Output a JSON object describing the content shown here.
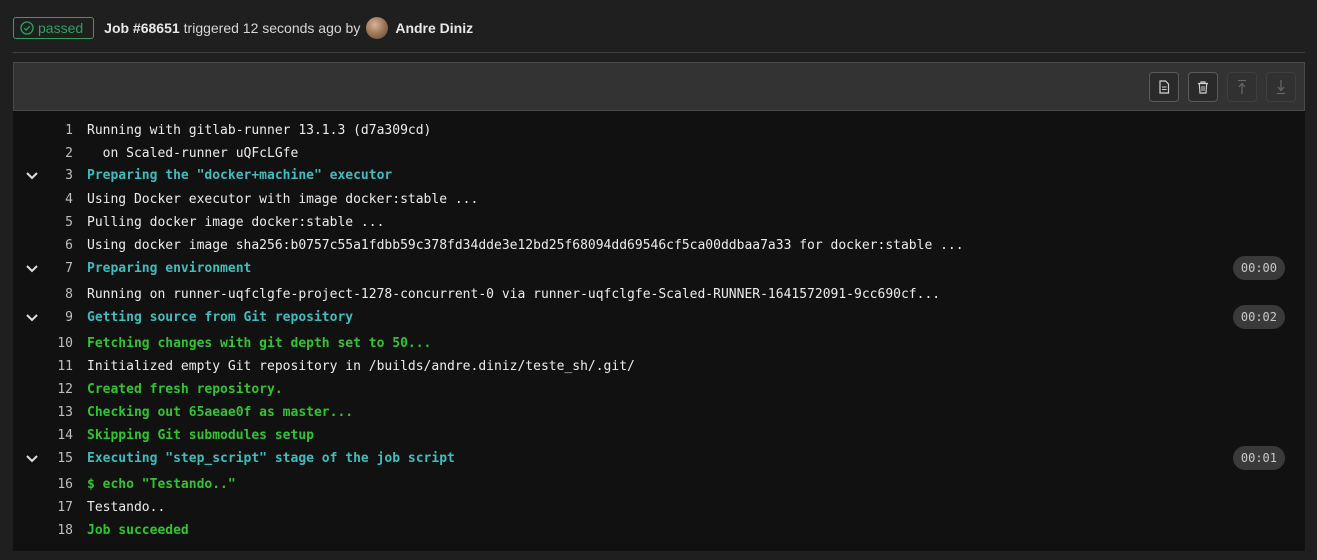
{
  "header": {
    "status": "passed",
    "job_label": "Job #68651",
    "trigger_text": "triggered 12 seconds ago by",
    "user_name": "Andre Diniz"
  },
  "toolbar": {
    "buttons": [
      "raw-log",
      "erase-log",
      "scroll-top",
      "scroll-bottom"
    ]
  },
  "colors": {
    "success": "#2da160",
    "section_header": "#3dbdbe",
    "ok_text": "#31c431",
    "log_bg": "#111111"
  },
  "log": {
    "lines": [
      {
        "num": "1",
        "text": "Running with gitlab-runner 13.1.3 (d7a309cd)",
        "style": "normal"
      },
      {
        "num": "2",
        "text": "  on Scaled-runner uQFcLGfe",
        "style": "normal"
      },
      {
        "num": "3",
        "text": "Preparing the \"docker+machine\" executor",
        "style": "section",
        "collapsible": true
      },
      {
        "num": "4",
        "text": "Using Docker executor with image docker:stable ...",
        "style": "normal"
      },
      {
        "num": "5",
        "text": "Pulling docker image docker:stable ...",
        "style": "normal"
      },
      {
        "num": "6",
        "text": "Using docker image sha256:b0757c55a1fdbb59c378fd34dde3e12bd25f68094dd69546cf5ca00ddbaa7a33 for docker:stable ...",
        "style": "normal"
      },
      {
        "num": "7",
        "text": "Preparing environment",
        "style": "section",
        "collapsible": true,
        "duration": "00:00"
      },
      {
        "num": "8",
        "text": "Running on runner-uqfclgfe-project-1278-concurrent-0 via runner-uqfclgfe-Scaled-RUNNER-1641572091-9cc690cf...",
        "style": "normal"
      },
      {
        "num": "9",
        "text": "Getting source from Git repository",
        "style": "section",
        "collapsible": true,
        "duration": "00:02"
      },
      {
        "num": "10",
        "text": "Fetching changes with git depth set to 50...",
        "style": "ok"
      },
      {
        "num": "11",
        "text": "Initialized empty Git repository in /builds/andre.diniz/teste_sh/.git/",
        "style": "normal"
      },
      {
        "num": "12",
        "text": "Created fresh repository.",
        "style": "ok"
      },
      {
        "num": "13",
        "text": "Checking out 65aeae0f as master...",
        "style": "ok"
      },
      {
        "num": "14",
        "text": "Skipping Git submodules setup",
        "style": "ok"
      },
      {
        "num": "15",
        "text": "Executing \"step_script\" stage of the job script",
        "style": "section",
        "collapsible": true,
        "duration": "00:01"
      },
      {
        "num": "16",
        "text": "$ echo \"Testando..\"",
        "style": "ok"
      },
      {
        "num": "17",
        "text": "Testando..",
        "style": "normal"
      },
      {
        "num": "18",
        "text": "Job succeeded",
        "style": "ok"
      }
    ]
  }
}
